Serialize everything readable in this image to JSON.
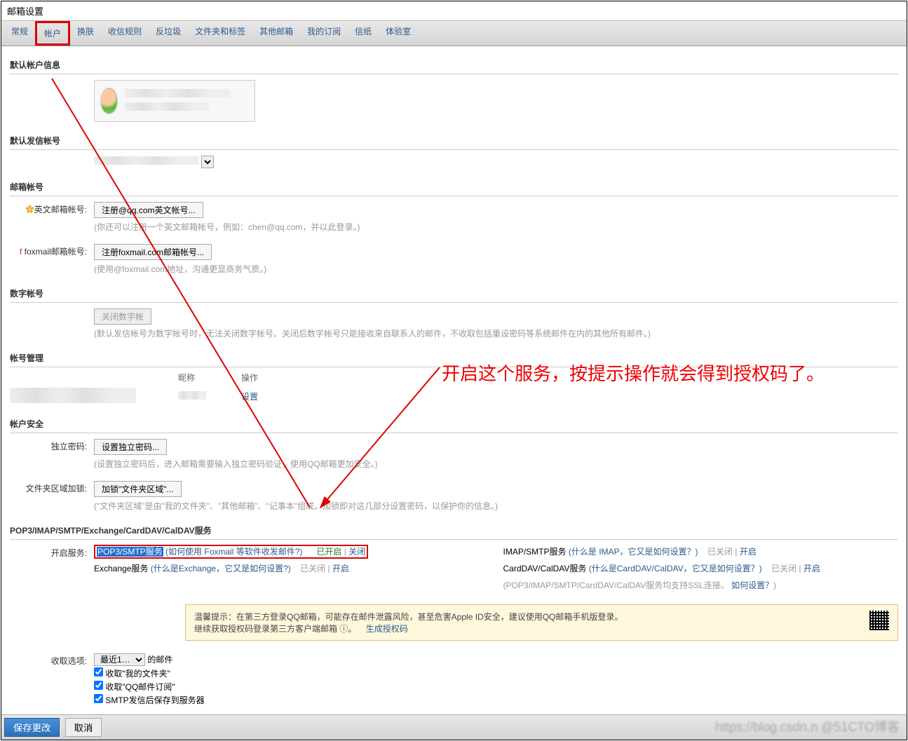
{
  "window_title": "邮箱设置",
  "tabs": [
    "常规",
    "帐户",
    "换肤",
    "收信规则",
    "反垃圾",
    "文件夹和标签",
    "其他邮箱",
    "我的订阅",
    "信纸",
    "体验室"
  ],
  "sections": {
    "default_account": {
      "title": "默认帐户信息"
    },
    "default_send": {
      "title": "默认发信帐号"
    },
    "mail_account": {
      "title": "邮箱帐号",
      "english": {
        "label": "英文邮箱帐号:",
        "button": "注册@qq.com英文帐号...",
        "hint": "(你还可以注册一个英文邮箱帐号，例如：chen@qq.com，并以此登录。)"
      },
      "foxmail": {
        "label": "foxmail邮箱帐号:",
        "button": "注册foxmail.com邮箱帐号...",
        "hint": "(使用@foxmail.com地址，沟通更显商务气质。)"
      }
    },
    "digital": {
      "title": "数字帐号",
      "button": "关闭数字帐",
      "hint": "(默认发信帐号为数字帐号时，无法关闭数字帐号。关闭后数字帐号只能接收来自联系人的邮件，不收取包括重设密码等系统邮件在内的其他所有邮件。)"
    },
    "manage": {
      "title": "帐号管理",
      "cols": {
        "nick": "昵称",
        "ops": "操作"
      },
      "settings": "设置"
    },
    "security": {
      "title": "帐户安全",
      "indie_pwd": {
        "label": "独立密码:",
        "button": "设置独立密码...",
        "hint": "(设置独立密码后，进入邮箱需要输入独立密码验证，使用QQ邮箱更加安全。)"
      },
      "folder_lock": {
        "label": "文件夹区域加锁:",
        "button": "加锁\"文件夹区域\"...",
        "hint": "(\"文件夹区域\"是由\"我的文件夹\"、\"其他邮箱\"、\"记事本\"组成。加锁即对这几部分设置密码，以保护你的信息。)"
      }
    },
    "services": {
      "title": "POP3/IMAP/SMTP/Exchange/CardDAV/CalDAV服务",
      "label": "开启服务:",
      "pop3": {
        "name": "POP3/SMTP服务",
        "help": "(如何使用 Foxmail 等软件收发邮件?)",
        "status": "已开启",
        "action": "关闭"
      },
      "exchange": {
        "name": "Exchange服务",
        "help": "(什么是Exchange，它又是如何设置?)",
        "status": "已关闭",
        "action": "开启"
      },
      "imap": {
        "name": "IMAP/SMTP服务",
        "help": "(什么是 IMAP，它又是如何设置？)",
        "status": "已关闭",
        "action": "开启"
      },
      "carddav": {
        "name": "CardDAV/CalDAV服务",
        "help": "(什么是CardDAV/CalDAV，它又是如何设置？)",
        "status": "已关闭",
        "action": "开启"
      },
      "ssl_note": "(POP3/IMAP/SMTP/CardDAV/CalDAV服务均支持SSL连接。",
      "ssl_link": "如何设置？",
      "tip": "温馨提示：在第三方登录QQ邮箱，可能存在邮件泄露风险，甚至危害Apple ID安全，建议使用QQ邮箱手机版登录。",
      "tip2_a": "继续获取授权码登录第三方客户端邮箱 ⓘ。",
      "tip2_link": "生成授权码"
    },
    "receive": {
      "title": "",
      "label": "收取选项:",
      "select_left": "最近1…",
      "suffix": "的邮件",
      "cb1": "收取\"我的文件夹\"",
      "cb2": "收取\"QQ邮件订阅\"",
      "cb3": "SMTP发信后保存到服务器"
    }
  },
  "footer": {
    "save": "保存更改",
    "cancel": "取消"
  },
  "annotation": "开启这个服务，按提示操作就会得到授权码了。",
  "watermark": "https://blog.csdn.n @51CTO博客"
}
